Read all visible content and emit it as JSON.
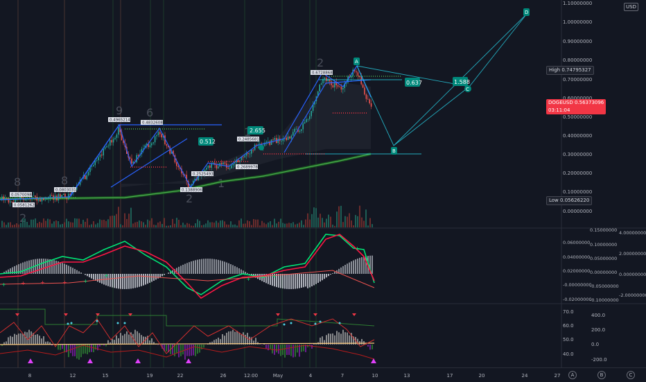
{
  "currency_badge": "USD",
  "price_axis": [
    "1.10000000",
    "1.00000000",
    "0.90000000",
    "0.80000000",
    "0.70000000",
    "0.60000000",
    "0.50000000",
    "0.40000000",
    "0.30000000",
    "0.20000000",
    "0.10000000",
    "0.00000000"
  ],
  "high_label": "High",
  "high_value": "0.74795327",
  "low_label": "Low",
  "low_value": "0.05626220",
  "current_symbol": "DOGEUSD",
  "current_price": "0.56373096",
  "countdown": "03:11:04",
  "macd_axis_left": [
    "0.06000000",
    "0.04000000",
    "0.02000000",
    "-0.00000000",
    "-0.02000000"
  ],
  "macd_axis_mid": [
    "0.15000000",
    "0.10000000",
    "0.05000000",
    "0.00000000",
    "-0.05000000",
    "-0.10000000"
  ],
  "macd_axis_right": [
    "4.00000000",
    "2.00000000",
    "0.00000000",
    "-2.00000000"
  ],
  "rsi_axis_left": [
    "70.0",
    "60.0",
    "50.0",
    "40.0"
  ],
  "rsi_axis_right": [
    "400.0",
    "200.0",
    "0.0",
    "-200.0"
  ],
  "x_axis": [
    "8",
    "12",
    "15",
    "19",
    "22",
    "26",
    "12:00",
    "May",
    "4",
    "7",
    "10",
    "13",
    "17",
    "20",
    "24",
    "27"
  ],
  "x_axis_circles": [
    "A",
    "B",
    "C"
  ],
  "wave_labels": {
    "A": "A",
    "B": "B",
    "C": "C",
    "D": "D"
  },
  "fib_boxes": [
    "2.655",
    "0.512",
    "0.637",
    "1.588"
  ],
  "small_labels": [
    "0.05700981",
    "0.05812621",
    "0.08030318",
    "0.49652140",
    "0.48326088",
    "0.13889064",
    "0.25254931",
    "0.24856810",
    "0.26899787",
    "0.67288686"
  ],
  "colors": {
    "bg": "#131722",
    "up": "#26a69a",
    "down": "#ef5350",
    "macd_fast": "#00e676",
    "macd_slow": "#ff1744",
    "wave": "#2962ff",
    "target": "#26c6da"
  }
}
